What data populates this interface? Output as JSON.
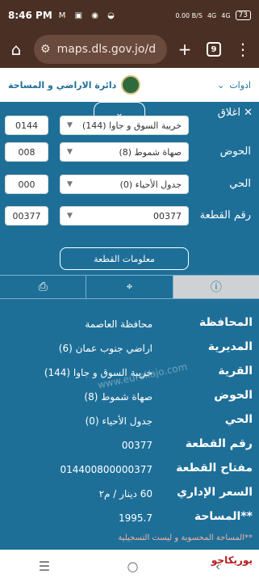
{
  "status": {
    "time": "8:46 PM",
    "left_icons": "M ▣ ◉ ◒",
    "speed": "0.00 B/S",
    "net1": "4G",
    "net2": "4G",
    "battery": "73"
  },
  "browser": {
    "url": "maps.dls.gov.jo/d",
    "tabs": "9"
  },
  "header": {
    "org": "دائرة الاراضي و المساحة",
    "tools": "ادوات"
  },
  "panel": {
    "close": "اغلاق"
  },
  "form": {
    "fields": [
      {
        "label": "الحوض",
        "value": "صهاة شموط (8)",
        "code": "008"
      },
      {
        "label": "الحي",
        "value": "جدول الأحياء (0)",
        "code": "000"
      },
      {
        "label": "رقم القطعة",
        "value": "00377",
        "code": "00377"
      }
    ],
    "top_partial": "خريبة السوق و جاوا (144)",
    "top_code": "0144",
    "button": "معلومات القطعة"
  },
  "details": [
    {
      "label": "المحافظة",
      "value": "محافظة العاصمة"
    },
    {
      "label": "المديرية",
      "value": "اراضي جنوب عمان (6)"
    },
    {
      "label": "القرية",
      "value": "خريبة السوق و جاوا (144)"
    },
    {
      "label": "الحوض",
      "value": "صهاة شموط (8)"
    },
    {
      "label": "الحي",
      "value": "جدول الأحياء (0)"
    },
    {
      "label": "رقم القطعة",
      "value": "00377"
    },
    {
      "label": "مفتاح القطعة",
      "value": "014400800000377"
    },
    {
      "label": "السعر الإداري",
      "value": "60 دينار / م٢"
    },
    {
      "label": "**المساحة",
      "value": "1995.7"
    }
  ],
  "footnote": "**المساحة المحسوبة و ليست التسجيلية",
  "watermark": "www.eurekajo.com",
  "brand": "يوريكاجو"
}
